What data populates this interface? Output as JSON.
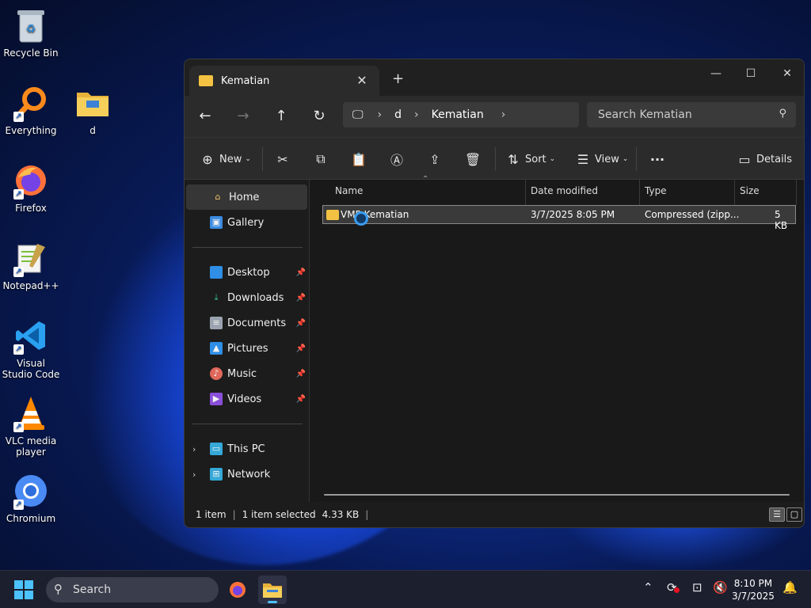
{
  "desktop": {
    "icons": [
      {
        "label": "Recycle Bin",
        "icon": "recycle-bin-icon"
      },
      {
        "label": "Everything",
        "icon": "everything-icon"
      },
      {
        "label": "d",
        "icon": "folder-icon"
      },
      {
        "label": "Firefox",
        "icon": "firefox-icon"
      },
      {
        "label": "Notepad++",
        "icon": "notepadpp-icon"
      },
      {
        "label": "Visual Studio Code",
        "icon": "vscode-icon"
      },
      {
        "label": "VLC media player",
        "icon": "vlc-icon"
      },
      {
        "label": "Chromium",
        "icon": "chromium-icon"
      }
    ]
  },
  "window": {
    "tab_title": "Kematian",
    "address": {
      "segments": [
        "d",
        "Kematian"
      ]
    },
    "search_placeholder": "Search Kematian",
    "toolbar": {
      "new_label": "New",
      "sort_label": "Sort",
      "view_label": "View",
      "details_label": "Details"
    },
    "sidebar": {
      "top": [
        {
          "label": "Home",
          "selected": true
        },
        {
          "label": "Gallery"
        }
      ],
      "pinned": [
        {
          "label": "Desktop"
        },
        {
          "label": "Downloads"
        },
        {
          "label": "Documents"
        },
        {
          "label": "Pictures"
        },
        {
          "label": "Music"
        },
        {
          "label": "Videos"
        }
      ],
      "locations": [
        {
          "label": "This PC"
        },
        {
          "label": "Network"
        }
      ]
    },
    "columns": [
      "Name",
      "Date modified",
      "Type",
      "Size"
    ],
    "files": [
      {
        "name": "VMP Kematian",
        "date": "3/7/2025 8:05 PM",
        "type": "Compressed (zipp...",
        "size": "5 KB"
      }
    ],
    "status": {
      "count": "1 item",
      "selected": "1 item selected",
      "size": "4.33 KB"
    }
  },
  "taskbar": {
    "search_label": "Search",
    "time": "8:10 PM",
    "date": "3/7/2025"
  },
  "colors": {
    "accent": "#4cc2ff",
    "folder": "#f3c242",
    "window_bg": "#1c1c1c"
  }
}
